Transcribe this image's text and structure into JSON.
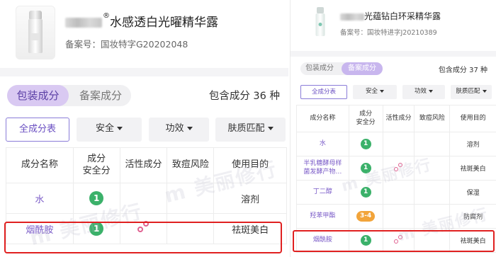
{
  "left": {
    "product": {
      "title": "水感透白光曜精华露",
      "reg_mark": "®",
      "record_number": "备案号：国妆特字G20202048"
    },
    "tabs": [
      {
        "label": "包装成分",
        "active": true
      },
      {
        "label": "备案成分",
        "active": false
      }
    ],
    "ingredient_count": "包含成分 36 种",
    "filters": [
      {
        "label": "全成分表",
        "primary": true
      },
      {
        "label": "安全",
        "has_caret": true
      },
      {
        "label": "功效",
        "has_caret": true
      },
      {
        "label": "肤质匹配",
        "has_caret": true
      }
    ],
    "table": {
      "headers": [
        "成分名称",
        "成分\n安全分",
        "活性成分",
        "致痘风险",
        "使用目的"
      ],
      "rows": [
        {
          "name": "水",
          "score": "1",
          "active": false,
          "acne": "",
          "purpose": "溶剂"
        },
        {
          "name": "烟酰胺",
          "score": "1",
          "active": true,
          "acne": "",
          "purpose": "祛斑美白",
          "highlighted": true
        }
      ]
    }
  },
  "right": {
    "product": {
      "title": "光蕴钻白环采精华露",
      "record_number": "备案号：国妆特进字J20210389"
    },
    "tabs": [
      {
        "label": "包装成分",
        "active": false
      },
      {
        "label": "备案成分",
        "active": true
      }
    ],
    "ingredient_count": "包含成分 37 种",
    "filters": [
      {
        "label": "全成分表",
        "primary": true
      },
      {
        "label": "安全",
        "has_caret": true
      },
      {
        "label": "功效",
        "has_caret": true
      },
      {
        "label": "肤质匹配",
        "has_caret": true
      }
    ],
    "table": {
      "headers": [
        "成分名称",
        "成分\n安全分",
        "活性成分",
        "致痘风险",
        "使用目的"
      ],
      "rows": [
        {
          "name": "水",
          "score": "1",
          "active": false,
          "purpose": "溶剂"
        },
        {
          "name": "半乳糖酵母样\n菌发酵产物…",
          "score": "1",
          "active": true,
          "purpose": "祛斑美白"
        },
        {
          "name": "丁二醇",
          "score": "1",
          "active": false,
          "purpose": "保湿"
        },
        {
          "name": "羟苯甲酯",
          "score": "3-4",
          "score_level": "warn",
          "active": false,
          "purpose": "防腐剂"
        },
        {
          "name": "烟酰胺",
          "score": "1",
          "active": true,
          "purpose": "祛斑美白",
          "highlighted": true
        }
      ]
    }
  },
  "colors": {
    "accent_purple": "#7b5cc8",
    "tab_active_bg": "#d9c9f2",
    "score_green": "#3bb16a",
    "score_orange": "#f2a43a",
    "highlight_red": "#e02020",
    "active_icon_pink": "#e06090"
  },
  "icons": {
    "active_ingredient": "linked-circles-icon",
    "dropdown": "caret-down-icon"
  }
}
